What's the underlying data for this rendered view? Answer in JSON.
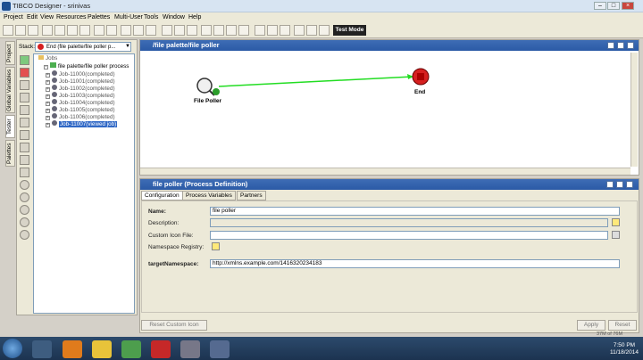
{
  "window": {
    "title": "TIBCO Designer - srinivas"
  },
  "menu": [
    "Project",
    "Edit",
    "View",
    "Resources",
    "Palettes",
    "Multi-User",
    "Tools",
    "Window",
    "Help"
  ],
  "toolbar": {
    "test_mode": "Test Mode"
  },
  "side_tabs": [
    "Project",
    "Global Variables",
    "Tester",
    "Palettes"
  ],
  "left": {
    "stack_label": "Stack:",
    "stack_value": "End (file palette/file poller p...",
    "tree_root": "Jobs",
    "process": "file palette/file poller process",
    "jobs": [
      "Job-11000(completed)",
      "Job-11001(completed)",
      "Job-11002(completed)",
      "Job-11003(completed)",
      "Job-11004(completed)",
      "Job-11005(completed)",
      "Job-11006(completed)",
      "Job-11007(viewed job)"
    ]
  },
  "canvas": {
    "title": "/file palette/file poller",
    "start_label": "File Poller",
    "end_label": "End"
  },
  "props": {
    "title": "file poller (Process Definition)",
    "tabs": [
      "Configuration",
      "Process Variables",
      "Partners"
    ],
    "fields": {
      "name_label": "Name:",
      "name_value": "file poller",
      "desc_label": "Description:",
      "icon_label": "Custom Icon File:",
      "ns_label": "Namespace Registry:",
      "tns_label": "targetNamespace:",
      "tns_value": "http://xmlns.example.com/1416320234183"
    },
    "reset_button": "Reset Custom Icon",
    "apply_button": "Apply",
    "reset2_button": "Reset"
  },
  "status": {
    "memory": "37M of 76M"
  },
  "clock": {
    "time": "7:50 PM",
    "date": "11/18/2014"
  },
  "colors": {
    "accent": "#2b5aa6",
    "arrow": "#22dd22",
    "end": "#d62020"
  }
}
